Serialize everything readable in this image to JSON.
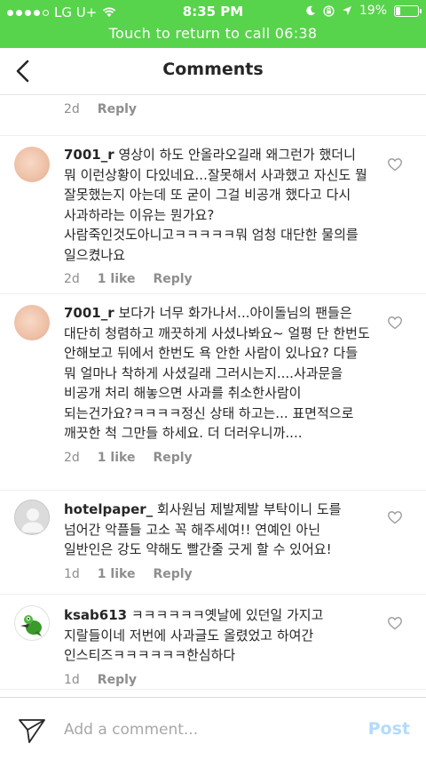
{
  "status_bar": {
    "carrier": "LG U+",
    "time": "8:35 PM",
    "battery": "19%",
    "signal_dots": 5,
    "signal_filled": 4,
    "battery_level": 0.19
  },
  "call_banner": "Touch to return to call 06:38",
  "header": {
    "title": "Comments"
  },
  "top_partial": {
    "time": "2d",
    "reply": "Reply"
  },
  "comments": [
    {
      "username": "7001_r",
      "text": "영상이 하도 안올라오길래 왜그런가 했더니 뭐 이런상황이 다있네요...잘못해서 사과했고 자신도 뭘 잘못했는지 아는데 또 굳이 그걸 비공개 했다고 다시 사과하라는 이유는 뭔가요? 사람죽인것도아니고ㅋㅋㅋㅋㅋ뭐 엄청 대단한 물의를 일으켰나요",
      "time": "2d",
      "likes": "1 like",
      "reply": "Reply",
      "avatar": "peach-avatar"
    },
    {
      "username": "7001_r",
      "text": "보다가 너무 화가나서...아이돌님의 팬들은 대단히 청렴하고 깨끗하게 사셨나봐요~ 얼평 단 한번도 안해보고 뒤에서 한번도 욕 안한 사람이 있나요? 다들 뭐 얼마나 착하게 사셨길래 그러시는지....사과문을 비공개 처리 해놓으면 사과를 취소한사람이 되는건가요?ㅋㅋㅋㅋ정신 상태 하고는... 표면적으로 깨끗한 척 그만들 하세요. 더 더러우니까....",
      "time": "2d",
      "likes": "1 like",
      "reply": "Reply",
      "avatar": "peach-avatar"
    },
    {
      "username": "hotelpaper_",
      "text": "회사원님 제발제발 부탁이니 도를 넘어간 악플들 고소 꼭 해주세여!! 연예인 아닌 일반인은 강도 약해도 빨간줄 긋게 할 수 있어요!",
      "time": "1d",
      "likes": "1 like",
      "reply": "Reply",
      "avatar": "default-avatar"
    },
    {
      "username": "ksab613",
      "text": "ㅋㅋㅋㅋㅋㅋ옛날에 있던일 가지고 지랄들이네 저번에 사과글도 올렸었고 하여간 인스티즈ㅋㅋㅋㅋㅋㅋ한심하다",
      "time": "1d",
      "likes": "",
      "reply": "Reply",
      "avatar": "frog-avatar"
    }
  ],
  "composer": {
    "placeholder": "Add a comment...",
    "post": "Post"
  },
  "colors": {
    "green_bar": "#58d34c",
    "post_disabled": "#b3dbff",
    "meta_gray": "#8e8e8e"
  }
}
